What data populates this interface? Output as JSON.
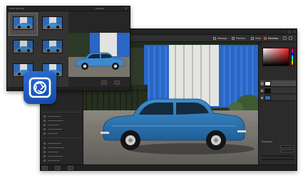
{
  "browser_window": {
    "title": "Photo Browser",
    "preview_title": "Preview",
    "thumbnails": [
      {
        "caption": ""
      },
      {
        "caption": ""
      },
      {
        "caption": ""
      },
      {
        "caption": ""
      },
      {
        "caption": ""
      },
      {
        "caption": ""
      }
    ]
  },
  "main_window": {
    "title": "",
    "toolbar": {
      "tabs": [
        {
          "label": "Manage",
          "icon": "manage-icon"
        },
        {
          "label": "Process",
          "icon": "process-icon"
        },
        {
          "label": "View",
          "icon": "view-icon"
        },
        {
          "label": "Develop",
          "icon": "develop-icon"
        }
      ],
      "active_tab": "Develop"
    },
    "left_panel": {
      "sections": [
        ""
      ]
    },
    "right_panel": {
      "layers": [
        {
          "name": ""
        },
        {
          "name": ""
        },
        {
          "name": ""
        }
      ],
      "properties_header": "Properties"
    },
    "status_bar": {
      "left_text": "",
      "zoom_text": "",
      "buttons": [
        "",
        "",
        ""
      ]
    }
  },
  "colors": {
    "accent": "#c82a2a",
    "logo": "#2b6fd6",
    "panel_bg": "#2a2a2a"
  }
}
